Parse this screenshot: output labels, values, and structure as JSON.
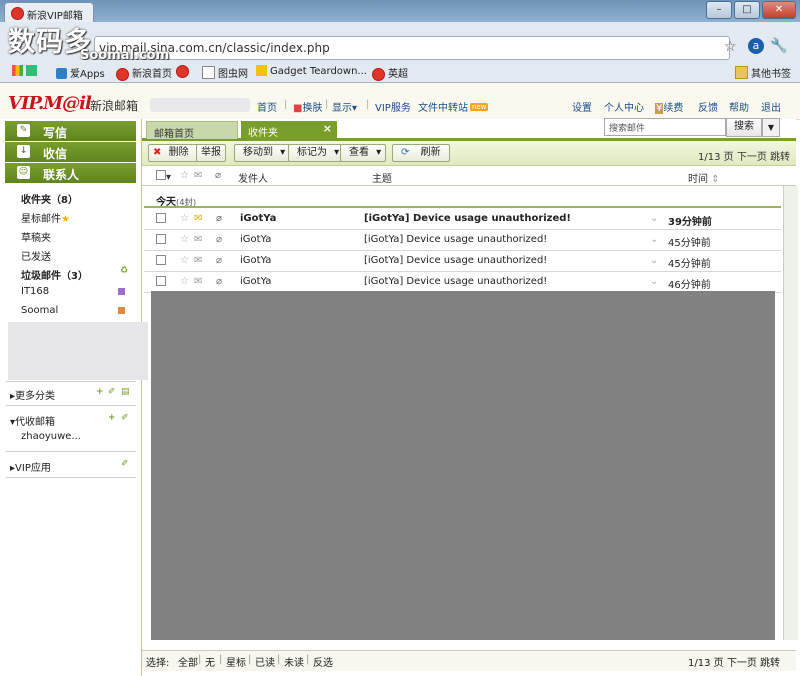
{
  "browser": {
    "tab_title": "新浪VIP邮箱",
    "url": "vip.mail.sina.com.cn/classic/index.php",
    "watermark": "数码多",
    "watermark_sub": "Soomal.com",
    "bookmarks": [
      "爱Apps",
      "新浪首页",
      "图虫网",
      "Gadget Teardown...",
      "英超"
    ],
    "other_bookmarks": "其他书签",
    "window_buttons": [
      "–",
      "□",
      "✕"
    ]
  },
  "header": {
    "logo": "VIP.M@il",
    "logo_text": "新浪邮箱",
    "nav": [
      "首页",
      "换肤",
      "显示",
      "VIP服务",
      "文件中转站"
    ],
    "nav_badge": "new",
    "right_nav": [
      "设置",
      "个人中心",
      "续费",
      "反馈",
      "帮助",
      "退出"
    ],
    "search_placeholder": "搜索邮件",
    "search_button": "搜索"
  },
  "sidebar": {
    "write": "写信",
    "receive": "收信",
    "contacts": "联系人",
    "folders": [
      {
        "label": "收件夹（8）",
        "bold": true
      },
      {
        "label": "星标邮件",
        "star": true
      },
      {
        "label": "草稿夹"
      },
      {
        "label": "已发送"
      },
      {
        "label": "垃圾邮件（3）",
        "bold": true
      },
      {
        "label": "IT168",
        "color": "#9b6fd0"
      },
      {
        "label": "Soomal",
        "color": "#e08a3c"
      }
    ],
    "sections": [
      "更多分类",
      "代收邮箱",
      "zhaoyuwe...",
      "VIP应用"
    ]
  },
  "tabs": {
    "home": "邮箱首页",
    "inbox": "收件夹"
  },
  "toolbar": {
    "delete": "删除",
    "report": "举报",
    "move": "移动到",
    "mark": "标记为",
    "view": "查看",
    "refresh": "刷新",
    "pager": "1/13 页   下一页   跳转"
  },
  "columns": {
    "sender": "发件人",
    "subject": "主题",
    "time": "时间"
  },
  "group_today": {
    "label": "今天",
    "count": "(4封)"
  },
  "emails": [
    {
      "sender": "iGotYa",
      "subject": "[iGotYa] Device usage unauthorized!",
      "time": "39分钟前",
      "unread": true
    },
    {
      "sender": "iGotYa",
      "subject": "[iGotYa] Device usage unauthorized!",
      "time": "45分钟前",
      "unread": false
    },
    {
      "sender": "iGotYa",
      "subject": "[iGotYa] Device usage unauthorized!",
      "time": "45分钟前",
      "unread": false
    },
    {
      "sender": "iGotYa",
      "subject": "[iGotYa] Device usage unauthorized!",
      "time": "46分钟前",
      "unread": false
    }
  ],
  "footer": {
    "select_label": "选择:",
    "options": [
      "全部",
      "无",
      "星标",
      "已读",
      "未读",
      "反选"
    ],
    "pager": "1/13 页   下一页   跳转"
  }
}
